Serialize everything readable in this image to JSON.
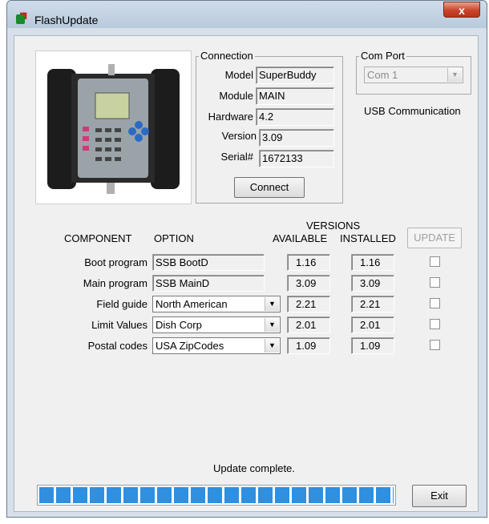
{
  "window": {
    "title": "FlashUpdate",
    "close_label": "x"
  },
  "connection": {
    "legend": "Connection",
    "model_label": "Model",
    "model_value": "SuperBuddy",
    "module_label": "Module",
    "module_value": "MAIN",
    "hardware_label": "Hardware",
    "hardware_value": "4.2",
    "version_label": "Version",
    "version_value": "3.09",
    "serial_label": "Serial#",
    "serial_value": "1672133",
    "connect_label": "Connect"
  },
  "com_port": {
    "legend": "Com Port",
    "selected": "Com 1",
    "status": "USB Communication"
  },
  "table": {
    "versions_header": "VERSIONS",
    "component_header": "COMPONENT",
    "option_header": "OPTION",
    "available_header": "AVAILABLE",
    "installed_header": "INSTALLED",
    "update_label": "UPDATE",
    "rows": [
      {
        "component": "Boot program",
        "option": "SSB BootD",
        "dropdown": false,
        "available": "1.16",
        "installed": "1.16"
      },
      {
        "component": "Main program",
        "option": "SSB MainD",
        "dropdown": false,
        "available": "3.09",
        "installed": "3.09"
      },
      {
        "component": "Field guide",
        "option": "North American",
        "dropdown": true,
        "available": "2.21",
        "installed": "2.21"
      },
      {
        "component": "Limit Values",
        "option": "Dish Corp",
        "dropdown": true,
        "available": "2.01",
        "installed": "2.01"
      },
      {
        "component": "Postal codes",
        "option": "USA ZipCodes",
        "dropdown": true,
        "available": "1.09",
        "installed": "1.09"
      }
    ]
  },
  "status": {
    "text": "Update complete.",
    "progress": 1.0
  },
  "exit_label": "Exit",
  "colors": {
    "progress": "#2f8fe0",
    "client_bg": "#f0f0f0",
    "frame": "#d7e0ea"
  }
}
